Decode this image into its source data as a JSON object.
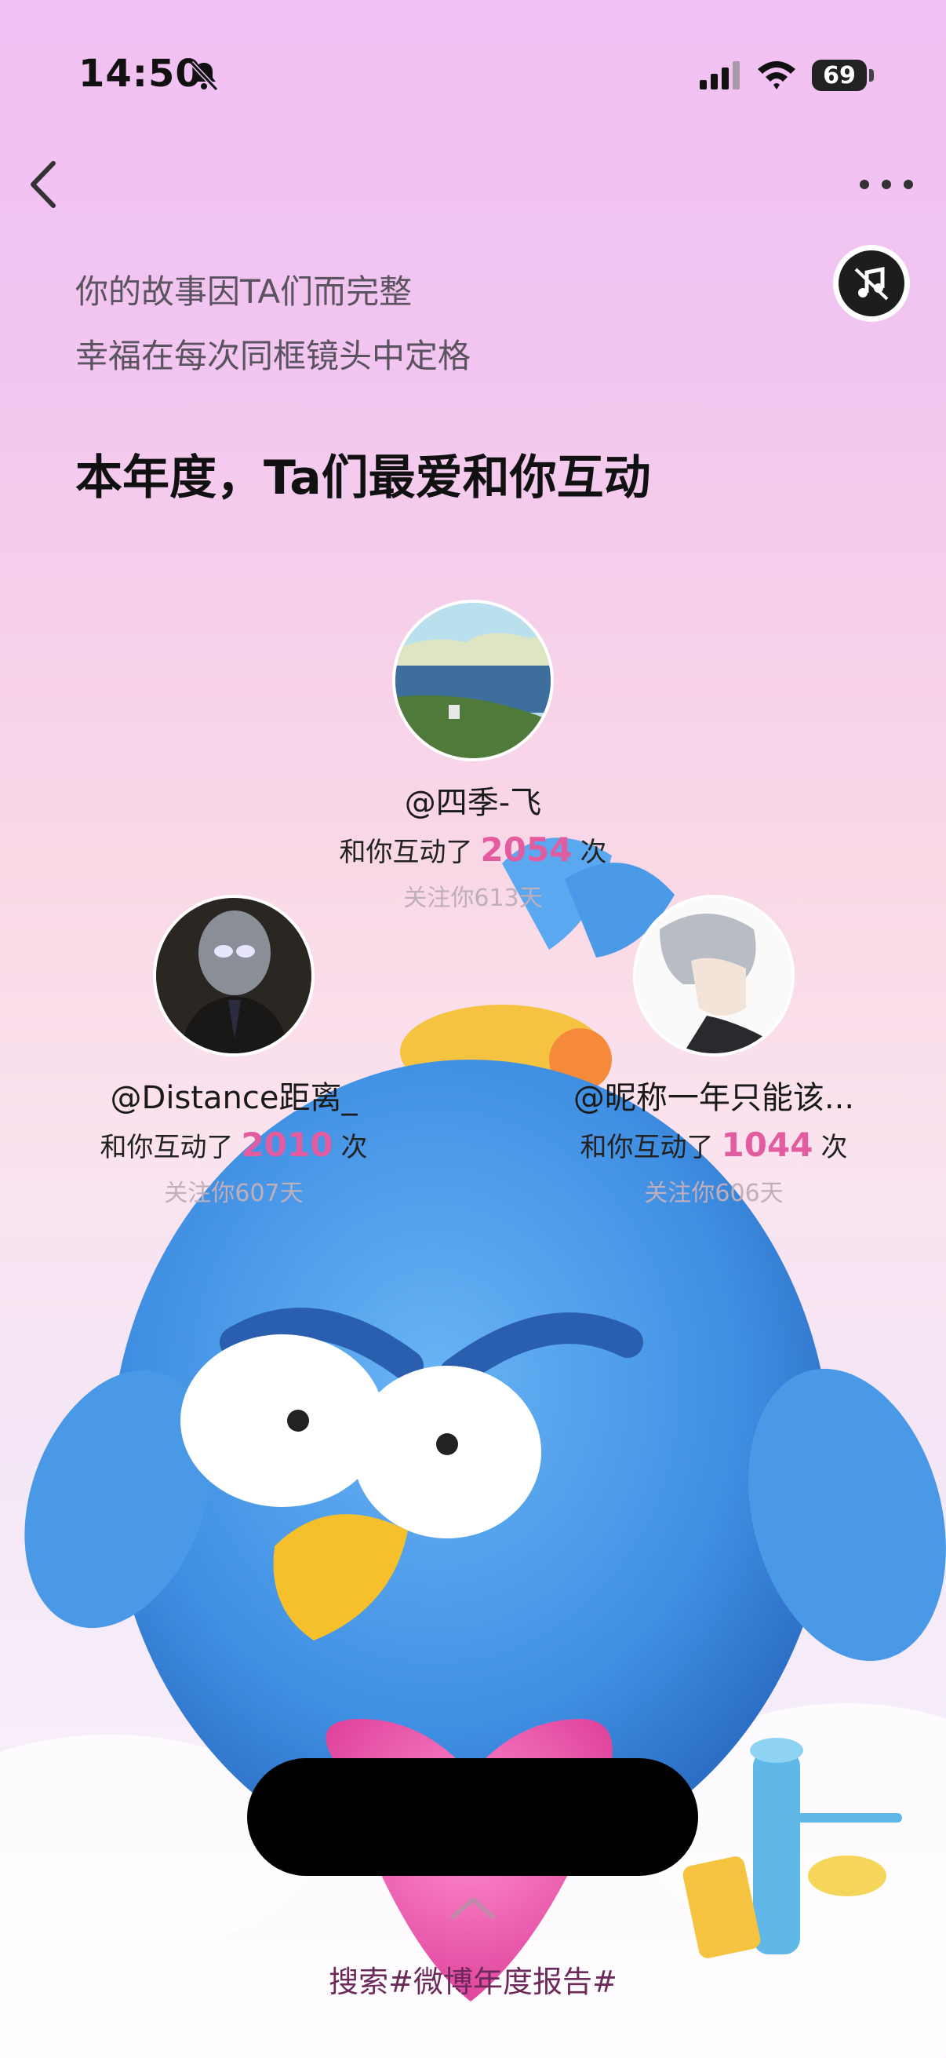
{
  "status_bar": {
    "time": "14:50",
    "battery": "69"
  },
  "intro": {
    "line1": "你的故事因TA们而完整",
    "line2": "幸福在每次同框镜头中定格"
  },
  "heading": "本年度，Ta们最爱和你互动",
  "interaction_prefix": "和你互动了",
  "interaction_suffix": "次",
  "friends": [
    {
      "name": "@四季-飞",
      "count": "2054",
      "follow_days": "关注你613天"
    },
    {
      "name": "@Distance距离_",
      "count": "2010",
      "follow_days": "关注你607天"
    },
    {
      "name": "@昵称一年只能该...",
      "count": "1044",
      "follow_days": "关注你606天"
    }
  ],
  "search_link": "搜索#微博年度报告#",
  "colors": {
    "accent": "#e45ca0",
    "mascot": "#3f8fe3"
  }
}
